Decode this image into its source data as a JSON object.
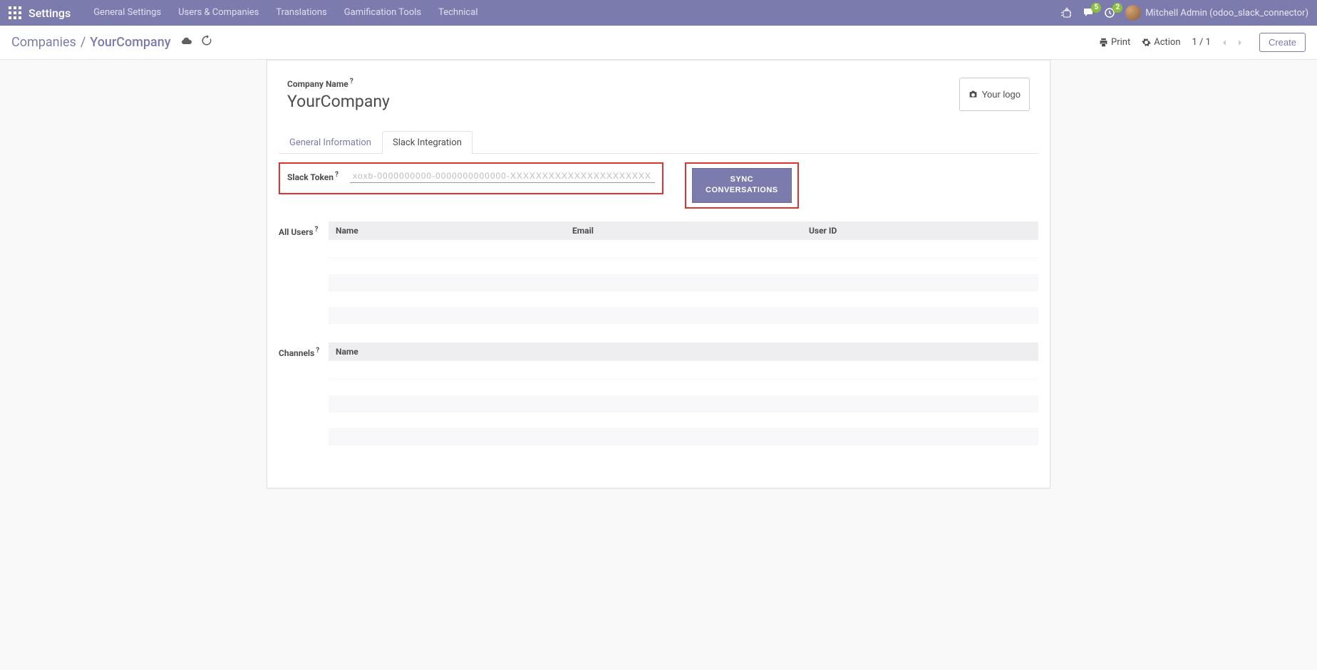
{
  "navbar": {
    "title": "Settings",
    "menu": [
      "General Settings",
      "Users & Companies",
      "Translations",
      "Gamification Tools",
      "Technical"
    ],
    "messages_badge": "5",
    "activities_badge": "2",
    "user_name": "Mitchell Admin (odoo_slack_connector)"
  },
  "control_panel": {
    "breadcrumb_root": "Companies",
    "breadcrumb_current": "YourCompany",
    "print": "Print",
    "action": "Action",
    "pager": "1 / 1",
    "create": "Create"
  },
  "form": {
    "company_name_label": "Company Name",
    "company_name": "YourCompany",
    "your_logo": "Your logo"
  },
  "tabs": {
    "general": "General Information",
    "slack": "Slack Integration"
  },
  "slack": {
    "token_label": "Slack Token",
    "token_value": "xoxb-0000000000-0000000000000-XXXXXXXXXXXXXXXXXXXXXXXX",
    "sync_button": "SYNC CONVERSATIONS"
  },
  "all_users": {
    "label": "All Users",
    "columns": {
      "name": "Name",
      "email": "Email",
      "user_id": "User ID"
    }
  },
  "channels": {
    "label": "Channels",
    "columns": {
      "name": "Name"
    }
  }
}
